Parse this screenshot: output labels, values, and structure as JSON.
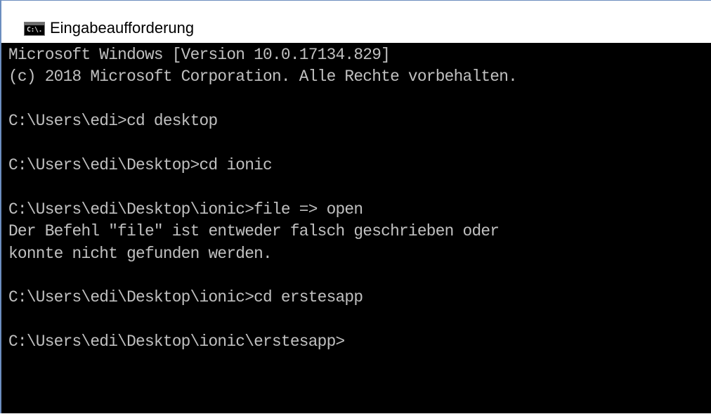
{
  "window": {
    "title": "Eingabeaufforderung",
    "icon_text": "C:\\."
  },
  "console": {
    "lines": [
      "Microsoft Windows [Version 10.0.17134.829]",
      "(c) 2018 Microsoft Corporation. Alle Rechte vorbehalten.",
      "",
      "C:\\Users\\edi>cd desktop",
      "",
      "C:\\Users\\edi\\Desktop>cd ionic",
      "",
      "C:\\Users\\edi\\Desktop\\ionic>file => open",
      "Der Befehl \"file\" ist entweder falsch geschrieben oder",
      "konnte nicht gefunden werden.",
      "",
      "C:\\Users\\edi\\Desktop\\ionic>cd erstesapp",
      "",
      "C:\\Users\\edi\\Desktop\\ionic\\erstesapp>"
    ]
  },
  "colors": {
    "console_background": "#000000",
    "console_text": "#c0c0c0",
    "titlebar_background": "#ffffff",
    "window_border": "#6c8ebf"
  },
  "icons": {
    "app_icon": "command-prompt-icon"
  }
}
